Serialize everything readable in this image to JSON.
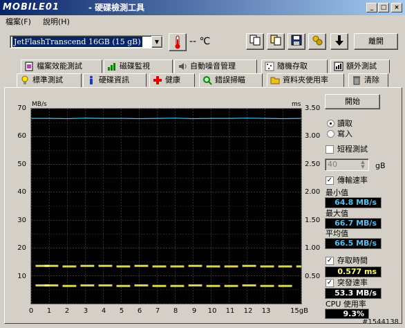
{
  "window": {
    "logo_text": "MOBILE01",
    "title": "- 硬碟檢測工具",
    "controls": [
      "_",
      "□",
      "×"
    ]
  },
  "menu": {
    "items": [
      "檔案(F)",
      "說明(H)"
    ]
  },
  "toolbar": {
    "drive": "JetFlashTranscend 16GB  (15 gB)",
    "temperature": "-- ℃",
    "exit_label": "離開",
    "icons": [
      "copy-icon",
      "copy-screen-icon",
      "save-icon",
      "options-icon",
      "down-arrow-icon"
    ]
  },
  "tabs": {
    "row1": [
      {
        "label": "檔案效能測試",
        "icon": "file-benchmark-icon"
      },
      {
        "label": "磁碟監視",
        "icon": "disk-monitor-icon"
      },
      {
        "label": "自動噪音管理",
        "icon": "speaker-icon"
      },
      {
        "label": "隨機存取",
        "icon": "random-access-icon"
      },
      {
        "label": "額外測試",
        "icon": "extra-test-icon"
      }
    ],
    "row2": [
      {
        "label": "標準測試",
        "icon": "lightbulb-icon",
        "active": true
      },
      {
        "label": "硬碟資訊",
        "icon": "info-icon"
      },
      {
        "label": "健康",
        "icon": "health-cross-icon"
      },
      {
        "label": "錯誤掃瞄",
        "icon": "magnifier-icon"
      },
      {
        "label": "資料夾使用率",
        "icon": "folder-icon"
      },
      {
        "label": "清除",
        "icon": "trash-icon"
      }
    ]
  },
  "chart_data": {
    "type": "scatter",
    "left_axis_unit": "MB/s",
    "right_axis_unit": "ms",
    "x_ticks": [
      "0",
      "1",
      "2",
      "3",
      "4",
      "5",
      "6",
      "7",
      "8",
      "9",
      "10",
      "11",
      "12",
      "13",
      "15gB"
    ],
    "y_ticks_left": [
      "70",
      "60",
      "50",
      "40",
      "30",
      "20",
      "10"
    ],
    "y_ticks_right": [
      "3.50",
      "3.00",
      "2.50",
      "2.00",
      "1.50",
      "1.00",
      "0.50"
    ],
    "ylim_left": [
      0,
      70
    ],
    "ylim_right": [
      0,
      3.5
    ],
    "xlim": [
      0,
      15
    ],
    "grid": true,
    "series": [
      {
        "color": "#4cc3f2",
        "kind": "line",
        "x": [
          0,
          1,
          2,
          3,
          4,
          5,
          6,
          7,
          8,
          9,
          10,
          11,
          12,
          13,
          14,
          15
        ],
        "values": [
          66.5,
          66.5,
          66.4,
          66.6,
          66.5,
          66.5,
          66.4,
          66.5,
          66.6,
          66.4,
          66.5,
          66.5,
          66.6,
          66.5,
          66.4,
          66.5
        ]
      },
      {
        "color": "#ffff66",
        "kind": "scatter",
        "x": [
          0.5,
          1,
          2,
          3,
          4,
          5,
          6,
          7,
          8,
          9,
          10,
          11,
          12,
          13,
          14,
          15
        ],
        "values": [
          0.68,
          0.68,
          0.67,
          0.68,
          0.68,
          0.67,
          0.68,
          0.67,
          0.67,
          0.68,
          0.67,
          0.67,
          0.68,
          0.67,
          0.67,
          0.67
        ]
      },
      {
        "color": "#ffff66",
        "kind": "scatter",
        "x": [
          0.5,
          1,
          2,
          3,
          4,
          5,
          6,
          7,
          8,
          9,
          10,
          11,
          12,
          13,
          14
        ],
        "values": [
          0.33,
          0.33,
          0.32,
          0.33,
          0.33,
          0.32,
          0.33,
          0.32,
          0.32,
          0.33,
          0.32,
          0.32,
          0.33,
          0.32,
          0.32
        ]
      }
    ]
  },
  "sidebar": {
    "start_label": "開始",
    "read_label": "讀取",
    "write_label": "寫入",
    "short_test_label": "短程測試",
    "short_test_value": "40",
    "short_test_unit": "gB",
    "transfer_rate_label": "傳輸速率",
    "min_label": "最小值",
    "min_value": "64.8 MB/s",
    "max_label": "最大值",
    "max_value": "66.7 MB/s",
    "avg_label": "平均值",
    "avg_value": "66.5 MB/s",
    "access_time_label": "存取時間",
    "access_time_value": "0.577 ms",
    "burst_rate_label": "突發速率",
    "burst_rate_value": "53.3 MB/s",
    "cpu_label": "CPU 使用率",
    "cpu_value": "9.3%"
  },
  "watermark": "#1544138"
}
